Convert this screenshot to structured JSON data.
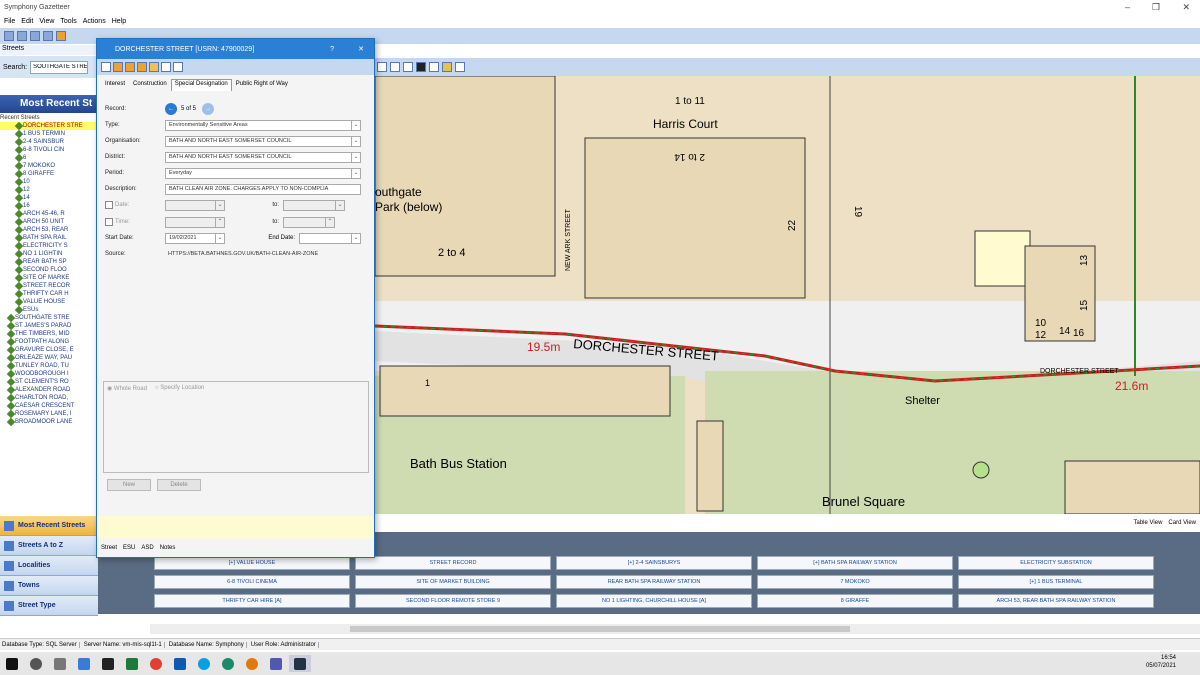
{
  "app": {
    "title": "Symphony Gazetteer",
    "menu": [
      "File",
      "Edit",
      "View",
      "Tools",
      "Actions",
      "Help"
    ]
  },
  "left": {
    "streets_label": "Streets",
    "search_label": "Search:",
    "search_value": "SOUTHGATE STREE",
    "most_recent_header": "Most Recent St",
    "recent_streets": "Recent Streets",
    "tree": [
      "DORCHESTER STRE",
      "1 BUS TERMIN",
      "2-4 SAINSBUR",
      "6-8 TIVOLI CIN",
      "6",
      "7 MOKOKO",
      "8 GIRAFFE",
      "10",
      "12",
      "14",
      "16",
      "ARCH 45-46, R",
      "ARCH 50 UNIT",
      "ARCH 53, REAR",
      "BATH SPA RAIL",
      "ELECTRICITY S",
      "NO 1 LIGHTIN",
      "REAR BATH SP",
      "SECOND FLOO",
      "SITE OF MARKE",
      "STREET RECOR",
      "THRIFTY CAR H",
      "VALUE HOUSE",
      "ESUs",
      "SOUTHGATE STRE",
      "ST JAMES'S PARAD",
      "THE TIMBERS, MID",
      "FOOTPATH ALONG",
      "GRAVURE CLOSE, E",
      "ORLEAZE WAY, PAU",
      "TUNLEY ROAD, TU",
      "WOODBOROUGH I",
      "ST CLEMENT'S RO",
      "ALEXANDER ROAD",
      "CHARLTON ROAD,",
      "CAESAR CRESCENT",
      "ROSEMARY LANE, I",
      "BROADMOOR LANE"
    ],
    "nav": [
      "Most Recent Streets",
      "Streets A to Z",
      "Localities",
      "Towns",
      "Street Type"
    ]
  },
  "dialog": {
    "title": "DORCHESTER STREET [USRN: 47900029]",
    "tabs": [
      "Interest",
      "Construction",
      "Special Designation",
      "Public Right of Way"
    ],
    "record_label": "Record:",
    "record_value": "5 of 5",
    "type_label": "Type:",
    "type_value": "Environmentally Sensitive Areas",
    "org_label": "Organisation:",
    "org_value": "BATH AND NORTH EAST SOMERSET COUNCIL",
    "district_label": "District:",
    "district_value": "BATH AND NORTH EAST SOMERSET COUNCIL",
    "period_label": "Period:",
    "period_value": "Everyday",
    "desc_label": "Description:",
    "desc_value": "BATH CLEAN AIR ZONE. CHARGES APPLY TO NON-COMPLIA",
    "date_label": "Date:",
    "to_label": "to:",
    "time_label": "Time:",
    "start_label": "Start Date:",
    "start_value": "19/02/2021",
    "end_label": "End Date:",
    "source_label": "Source:",
    "source_value": "HTTPS://BETA.BATHNES.GOV.UK/BATH-CLEAN-AIR-ZONE",
    "radio_whole": "Whole Road",
    "radio_specify": "Specify Location",
    "new_btn": "New",
    "delete_btn": "Delete",
    "foot": [
      "Street",
      "ESU",
      "ASD",
      "Notes"
    ]
  },
  "map": {
    "labels": [
      "Harris Court",
      "1 to 11",
      "2 to 14",
      "outhgate",
      "Park (below)",
      "2 to 4",
      "NEW ARK STREET",
      "22",
      "19",
      "DORCHESTER STREET",
      "19.5m",
      "21.6m",
      "Shelter",
      "Bath Bus Station",
      "Brunel Square",
      "1",
      "10",
      "12",
      "14",
      "16",
      "13",
      "15",
      "DORCHESTER STREET"
    ],
    "colors": {
      "ground": "#ede0c4",
      "road": "#f7f7f7",
      "green": "#cfdcb2",
      "building": "#e9d8b6"
    }
  },
  "view_toggle": [
    "Table View",
    "Card View"
  ],
  "grid": [
    [
      "[+] VALUE HOUSE",
      "STREET RECORD",
      "[+] 2-4 SAINSBURYS",
      "[+] BATH SPA RAILWAY STATION",
      "ELECTRICITY SUBSTATION"
    ],
    [
      "6-8 TIVOLI CINEMA",
      "SITE OF MARKET BUILDING",
      "REAR BATH SPA RAILWAY STATION",
      "7 MOKOKO",
      "[+] 1 BUS TERMINAL"
    ],
    [
      "THRIFTY CAR HIRE [A]",
      "SECOND FLOOR REMOTE STORE 9",
      "NO 1 LIGHTING, CHURCHILL HOUSE [A]",
      "8 GIRAFFE",
      "ARCH 53, REAR BATH SPA RAILWAY STATION"
    ]
  ],
  "status": [
    "Database Type: SQL Server",
    "Server Name: vm-mis-sql1t-1",
    "Database Name: Symphony",
    "User Role: Administrator"
  ],
  "clock": {
    "time": "16:54",
    "date": "05/07/2021"
  }
}
